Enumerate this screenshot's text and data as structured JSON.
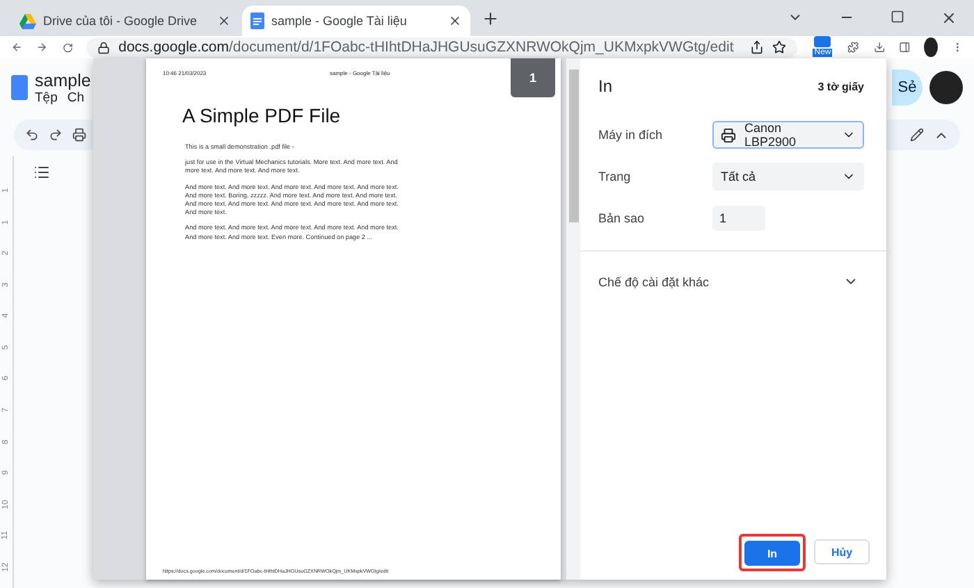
{
  "browser": {
    "tabs": [
      {
        "title": "Drive của tôi - Google Drive",
        "selected": false,
        "kind": "drive"
      },
      {
        "title": "sample - Google Tài liệu",
        "selected": true,
        "kind": "docs"
      }
    ],
    "url_host": "docs.google.com",
    "url_path": "/document/d/1FOabc-tHIhtDHaJHGUsuGZXNRWOkQjm_UKMxpkVWGtg/edit",
    "extension_badge": "New"
  },
  "docs": {
    "title": "sample",
    "menu": [
      "Tệp",
      "Ch"
    ],
    "share_button": "Sẻ",
    "ruler": [
      "1",
      "1",
      "2",
      "3",
      "4",
      "5",
      "6",
      "7",
      "8",
      "9",
      "10",
      "11",
      "12"
    ]
  },
  "preview": {
    "page_number": "1",
    "header_left": "10:46 21/03/2023",
    "header_center": "sample - Google Tài liệu",
    "heading": "A Simple PDF File",
    "paragraphs": [
      "This is a small demonstration .pdf file -",
      "just for use in the Virtual Mechanics tutorials. More text. And more text. And more text. And more text. And more text.",
      "And more text. And more text. And more text. And more text. And more text. And more text. Boring, zzzzz. And more text. And more text. And more text. And more text. And more text. And more text. And more text. And more text. And more text.",
      "And more text. And more text. And more text. And more text. And more text. And more text. And more text. Even more. Continued on page 2 ..."
    ],
    "footer": "https://docs.google.com/document/d/1FOabc-tHIhtDHaJHGUsuGZXNRWOkQjm_UKMxpkVWGtg/edit"
  },
  "print_panel": {
    "title": "In",
    "sheets": "3 tờ giấy",
    "settings": [
      {
        "label": "Máy in đích",
        "kind": "printer",
        "value": "Canon LBP2900",
        "focused": true
      },
      {
        "label": "Trang",
        "kind": "select",
        "value": "Tất cả",
        "focused": false
      },
      {
        "label": "Bản sao",
        "kind": "number",
        "value": "1",
        "focused": false
      }
    ],
    "more_settings": {
      "label": "Chế độ cài đặt khác",
      "expanded": false
    },
    "buttons": [
      {
        "label": "In",
        "kind": "primary",
        "highlighted": true
      },
      {
        "label": "Hủy",
        "kind": "secondary",
        "highlighted": false
      }
    ]
  }
}
